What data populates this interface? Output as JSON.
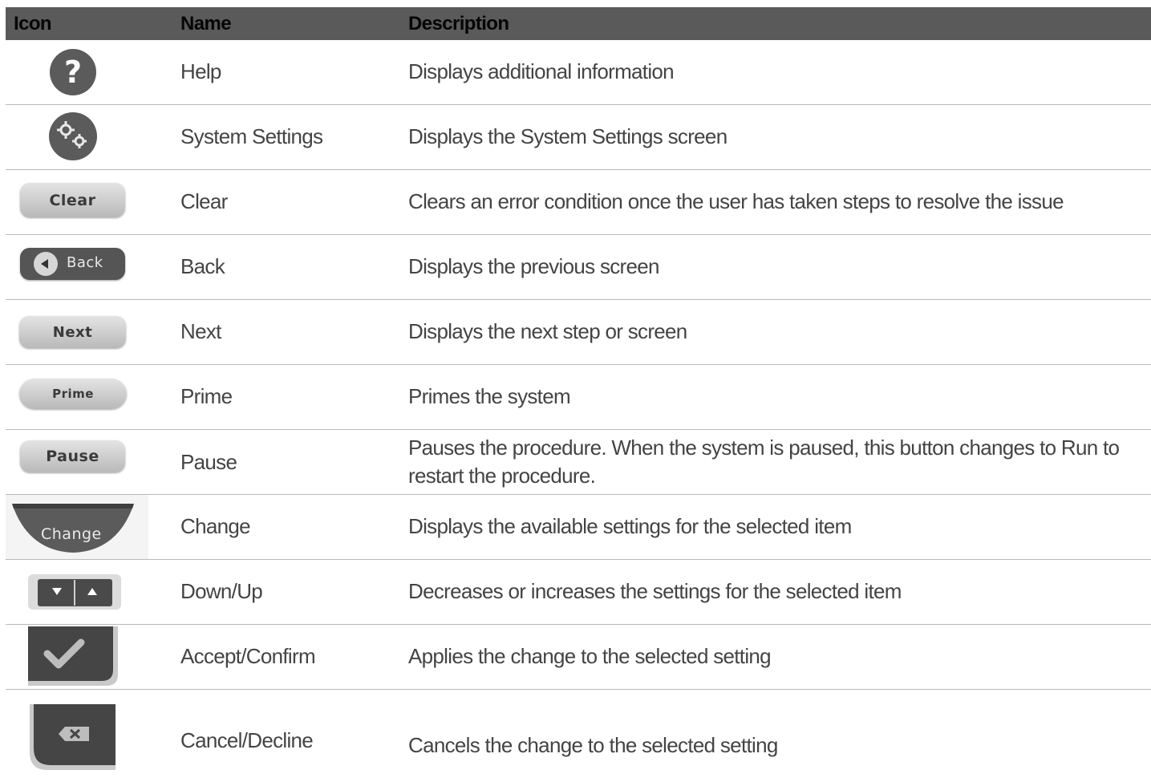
{
  "headers": {
    "icon": "Icon",
    "name": "Name",
    "description": "Description"
  },
  "rows": [
    {
      "icon": "help-icon",
      "name": "Help",
      "description": "Displays additional information"
    },
    {
      "icon": "gears-icon",
      "name": "System Settings",
      "description": "Displays the System Settings screen"
    },
    {
      "icon": "clear-button-icon",
      "icon_label": "Clear",
      "name": "Clear",
      "description": "Clears an error condition once the user has taken steps to resolve the issue"
    },
    {
      "icon": "back-button-icon",
      "icon_label": "Back",
      "name": "Back",
      "description": "Displays the previous screen"
    },
    {
      "icon": "next-button-icon",
      "icon_label": "Next",
      "name": "Next",
      "description": "Displays the next step or screen"
    },
    {
      "icon": "prime-button-icon",
      "icon_label": "Prime",
      "name": "Prime",
      "description": "Primes the system"
    },
    {
      "icon": "pause-button-icon",
      "icon_label": "Pause",
      "name": "Pause",
      "description": "Pauses the procedure. When the system is paused, this button changes to Run to restart the procedure."
    },
    {
      "icon": "change-button-icon",
      "icon_label": "Change",
      "name": "Change",
      "description": "Displays the available settings for the selected item"
    },
    {
      "icon": "down-up-icon",
      "name": "Down/Up",
      "description": "Decreases or increases the settings for the selected item"
    },
    {
      "icon": "checkmark-icon",
      "name": "Accept/Confirm",
      "description": "Applies the change to the selected setting"
    },
    {
      "icon": "cancel-x-icon",
      "name": "Cancel/Decline",
      "description": "Cancels the change to the selected setting"
    }
  ],
  "colors": {
    "header_bg": "#5a5a5a",
    "icon_dark": "#555555",
    "divider": "#b9b9b9"
  }
}
